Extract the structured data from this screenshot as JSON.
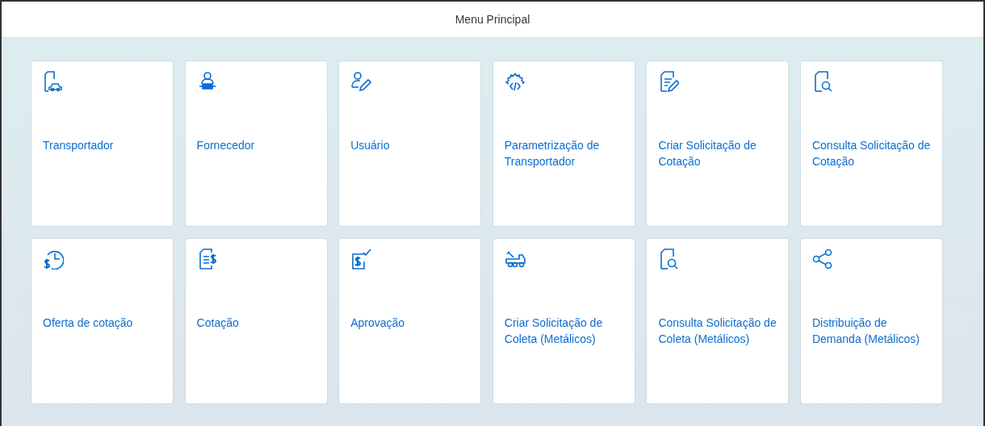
{
  "header": {
    "title": "Menu Principal"
  },
  "tiles": [
    {
      "label": "Transportador"
    },
    {
      "label": "Fornecedor"
    },
    {
      "label": "Usuário"
    },
    {
      "label": "Parametrização de Transportador"
    },
    {
      "label": "Criar Solicitação de Cotação"
    },
    {
      "label": "Consulta Solicitação de Cotação"
    },
    {
      "label": "Oferta de cotação"
    },
    {
      "label": "Cotação"
    },
    {
      "label": "Aprovação"
    },
    {
      "label": "Criar Solicitação de Coleta (Metálicos)"
    },
    {
      "label": "Consulta Solicitação de Coleta (Metálicos)"
    },
    {
      "label": "Distribuição de Demanda (Metálicos)"
    }
  ]
}
